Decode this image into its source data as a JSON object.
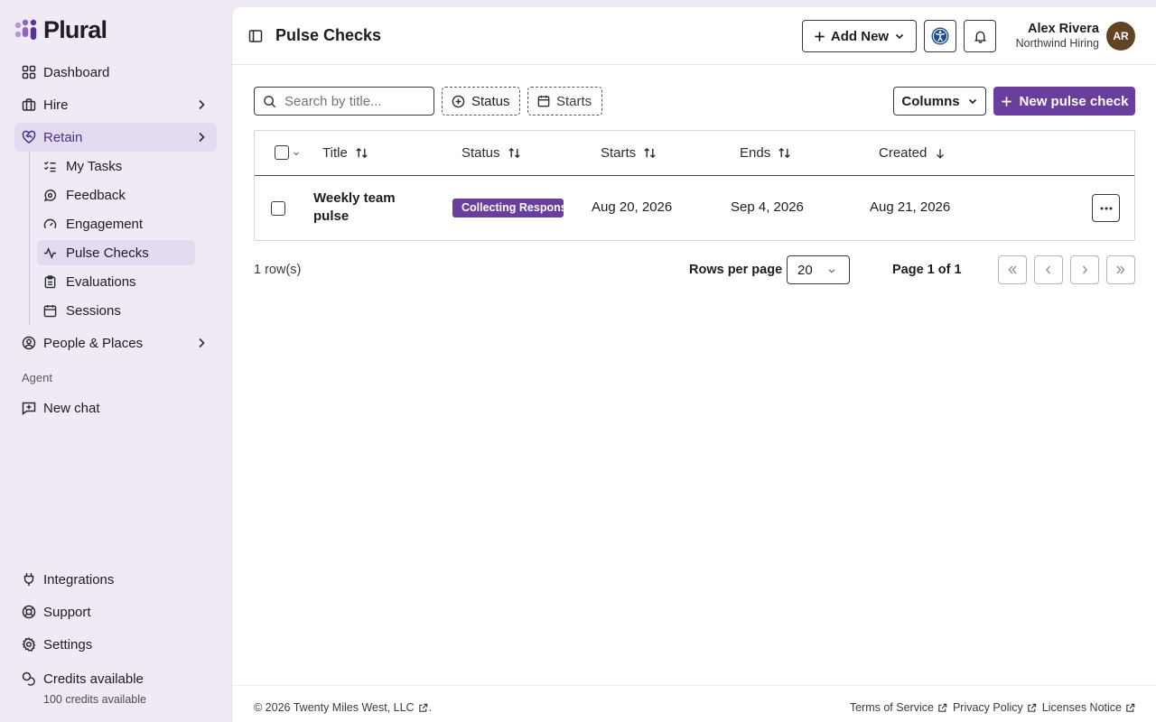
{
  "brand": {
    "name": "Plural"
  },
  "sidebar": {
    "dashboard": "Dashboard",
    "hire": "Hire",
    "retain": "Retain",
    "retain_items": [
      "My Tasks",
      "Feedback",
      "Engagement",
      "Pulse Checks",
      "Evaluations",
      "Sessions"
    ],
    "people_places": "People & Places",
    "agent_section": "Agent",
    "new_chat": "New chat",
    "integrations": "Integrations",
    "support": "Support",
    "settings": "Settings",
    "credits_title": "Credits available",
    "credits_sub": "100 credits available"
  },
  "header": {
    "title": "Pulse Checks",
    "add_new": "Add New",
    "user_name": "Alex Rivera",
    "user_org": "Northwind Hiring",
    "avatar_initials": "AR"
  },
  "toolbar": {
    "search_placeholder": "Search by title...",
    "status_filter": "Status",
    "starts_filter": "Starts",
    "columns": "Columns",
    "new_pulse_check": "New pulse check"
  },
  "table": {
    "columns": [
      "Title",
      "Status",
      "Starts",
      "Ends",
      "Created"
    ],
    "rows": [
      {
        "title": "Weekly team pulse",
        "status": "Collecting Responses",
        "starts": "Aug 20, 2026",
        "ends": "Sep 4, 2026",
        "created": "Aug 21, 2026"
      }
    ]
  },
  "pagination": {
    "row_count": "1 row(s)",
    "rows_per_page_label": "Rows per page",
    "rows_per_page": "20",
    "page_of": "Page 1 of 1"
  },
  "footer": {
    "copyright": "© 2026 Twenty Miles West, LLC",
    "copyright_suffix": ".",
    "links": [
      "Terms of Service",
      "Privacy Policy",
      "Licenses Notice"
    ]
  },
  "colors": {
    "accent": "#6a3e9d",
    "sidebar_bg": "#efeaf6",
    "active_bg": "#e3dbef",
    "avatar_bg": "#634322",
    "a11y_blue": "#1f4e8c"
  }
}
